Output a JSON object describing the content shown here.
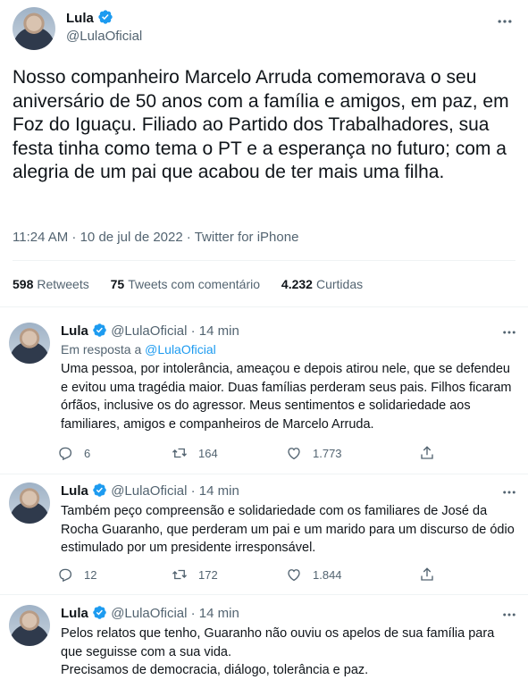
{
  "main": {
    "name": "Lula",
    "handle": "@LulaOficial",
    "text": "Nosso companheiro Marcelo Arruda comemorava o seu aniversário de 50 anos com a família e amigos, em paz, em Foz do Iguaçu. Filiado ao Partido dos Trabalhadores, sua festa tinha como tema o PT e a esperança no futuro; com a alegria de um pai que acabou de ter mais uma filha.",
    "time": "11:24 AM · 10 de jul de 2022",
    "source": "Twitter for iPhone",
    "retweets_count": "598",
    "retweets_label": "Retweets",
    "quotes_count": "75",
    "quotes_label": "Tweets com comentário",
    "likes_count": "4.232",
    "likes_label": "Curtidas"
  },
  "replies": [
    {
      "name": "Lula",
      "handle": "@LulaOficial",
      "time": "· 14 min",
      "reply_to_prefix": "Em resposta a",
      "reply_to_handle": "@LulaOficial",
      "text": "Uma pessoa, por intolerância, ameaçou e depois atirou nele, que se defendeu e evitou uma tragédia maior. Duas famílias perderam seus pais. Filhos ficaram órfãos, inclusive os do agressor. Meus sentimentos e solidariedade aos familiares, amigos e companheiros de Marcelo Arruda.",
      "replies": "6",
      "retweets": "164",
      "likes": "1.773"
    },
    {
      "name": "Lula",
      "handle": "@LulaOficial",
      "time": "· 14 min",
      "text": "Também peço compreensão e solidariedade com os familiares de José da Rocha Guaranho, que perderam um pai e um marido para um discurso de ódio estimulado por um presidente irresponsável.",
      "replies": "12",
      "retweets": "172",
      "likes": "1.844"
    },
    {
      "name": "Lula",
      "handle": "@LulaOficial",
      "time": "· 14 min",
      "text": "Pelos relatos que tenho, Guaranho não ouviu os apelos de sua família para que seguisse com a sua vida.",
      "text2": "Precisamos de democracia, diálogo, tolerância e paz."
    }
  ],
  "colors": {
    "accent": "#1d9bf0",
    "muted": "#536471",
    "text": "#0f1419",
    "divider": "#eff3f4"
  },
  "icons": [
    "verified-badge-icon",
    "more-icon",
    "reply-icon",
    "retweet-icon",
    "like-icon",
    "share-icon"
  ]
}
